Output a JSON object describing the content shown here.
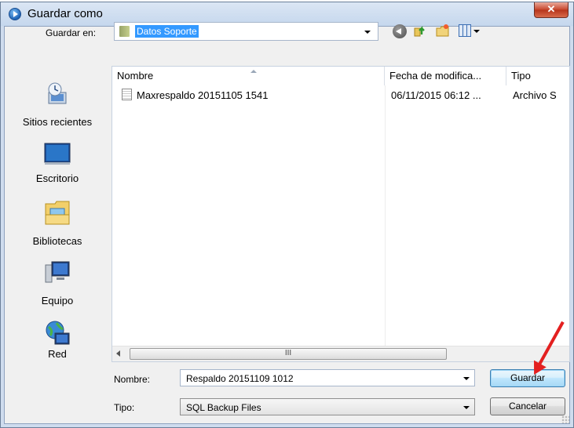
{
  "window": {
    "title": "Guardar como"
  },
  "toolbar": {
    "save_in_label": "Guardar en:",
    "save_in_value": "Datos Soporte"
  },
  "nav": {
    "items": [
      {
        "label": "Sitios recientes",
        "icon": "recent-places-icon"
      },
      {
        "label": "Escritorio",
        "icon": "desktop-icon"
      },
      {
        "label": "Bibliotecas",
        "icon": "libraries-icon"
      },
      {
        "label": "Equipo",
        "icon": "computer-icon"
      },
      {
        "label": "Red",
        "icon": "network-icon"
      }
    ]
  },
  "list": {
    "columns": [
      "Nombre",
      "Fecha de modifica...",
      "Tipo"
    ],
    "rows": [
      {
        "name": "Maxrespaldo 20151105 1541",
        "date": "06/11/2015 06:12 ...",
        "type": "Archivo S"
      }
    ],
    "scroll_thumb": "III"
  },
  "form": {
    "name_label": "Nombre:",
    "name_value": "Respaldo 20151109 1012",
    "type_label": "Tipo:",
    "type_value": "SQL Backup Files",
    "save_button": "Guardar",
    "cancel_button": "Cancelar"
  },
  "colors": {
    "selection": "#3399ff",
    "annotation_arrow": "#e32020",
    "close_button": "#c7452b"
  }
}
